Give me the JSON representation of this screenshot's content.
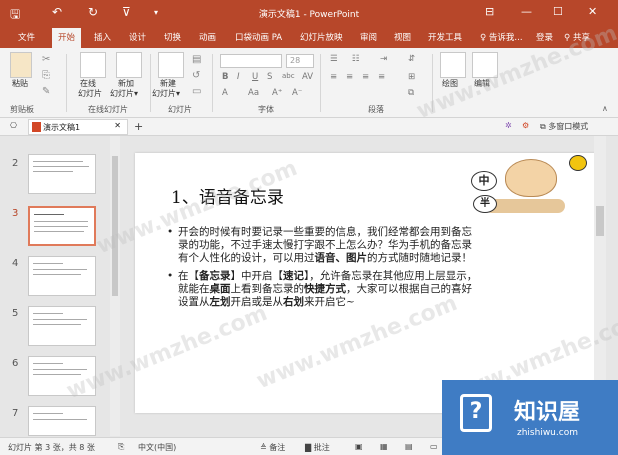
{
  "titlebar": {
    "document_title": "演示文稿1 - PowerPoint",
    "save_icon": "save-icon",
    "undo_icon": "undo-icon",
    "redo_icon": "redo-icon",
    "minimize": "—",
    "maximize": "☐",
    "close": "✕"
  },
  "tabs": [
    {
      "label": "文件"
    },
    {
      "label": "开始"
    },
    {
      "label": "插入"
    },
    {
      "label": "设计"
    },
    {
      "label": "切换"
    },
    {
      "label": "动画"
    },
    {
      "label": "口袋动画 PA"
    },
    {
      "label": "幻灯片放映"
    },
    {
      "label": "审阅"
    },
    {
      "label": "视图"
    },
    {
      "label": "开发工具"
    }
  ],
  "tell_me": "♀ 告诉我...",
  "login": "登录",
  "share": "共享",
  "ribbon": {
    "paste": "粘贴",
    "slides_new": "在线",
    "new_slide": "新加",
    "new_slide2": "新建",
    "group_clipboard": "剪贴板",
    "group_online": "在线幻灯片",
    "group_slides": "幻灯片",
    "group_font": "字体",
    "group_paragraph": "段落",
    "drawing": "绘图",
    "editing": "编辑",
    "slide_sub1": "幻灯片",
    "slide_sub2": "幻灯片▾",
    "new_sub": "新建"
  },
  "docbar": {
    "doc_tab": "演示文稿1",
    "multi_window": "多窗口模式"
  },
  "thumbnails": [
    {
      "num": "2"
    },
    {
      "num": "3"
    },
    {
      "num": "4"
    },
    {
      "num": "5"
    },
    {
      "num": "6"
    },
    {
      "num": "7"
    }
  ],
  "slide": {
    "title": "1、语音备忘录",
    "bullet1_line1": "开会的时候有时要记录一些重要的信息，我们经常都会用到备忘",
    "bullet1_line2": "录的功能，不过手速太慢打字跟不上怎么办？华为手机的备忘录",
    "bullet1_line3_a": "有个人性化的设计，可以用过",
    "bullet1_line3_b": "语音、图片",
    "bullet1_line3_c": "的方式随时随地记录！",
    "bullet2_line1_a": "在【",
    "bullet2_line1_b": "备忘录",
    "bullet2_line1_c": "】中开启【",
    "bullet2_line1_d": "速记",
    "bullet2_line1_e": "】，允许备忘录在其他应用上层显示，",
    "bullet2_line2_a": "就能在",
    "bullet2_line2_b": "桌面",
    "bullet2_line2_c": "上看到备忘录的",
    "bullet2_line2_d": "快捷方式",
    "bullet2_line2_e": "，大家可以根据自己的喜好",
    "bullet2_line3_a": "设置从",
    "bullet2_line3_b": "左划",
    "bullet2_line3_c": "开启或是从",
    "bullet2_line3_d": "右划",
    "bullet2_line3_e": "来开启它~",
    "sticker_zhong": "中",
    "sticker_ban": "半"
  },
  "status": {
    "slide_info": "幻灯片 第 3 张，共 8 张",
    "language": "中文(中国)",
    "notes": "≜ 备注",
    "comments": "▇ 批注"
  },
  "watermark": "www.wmzhe.com",
  "brand": {
    "name": "知识屋",
    "url": "zhishiwu.com",
    "icon": "?"
  },
  "colors": {
    "accent": "#b7472a",
    "brand_blue": "#3f7cc4"
  }
}
